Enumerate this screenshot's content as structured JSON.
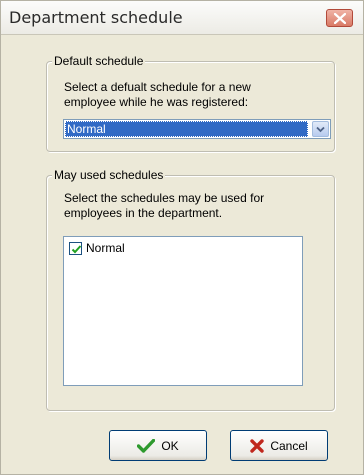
{
  "dialog": {
    "title": "Department schedule"
  },
  "default_schedule": {
    "legend": "Default schedule",
    "description_line1": "Select a defualt schedule for a new",
    "description_line2": "employee while he was registered:",
    "selected_value": "Normal"
  },
  "may_used_schedules": {
    "legend": "May used schedules",
    "description_line1": "Select the schedules may be used for",
    "description_line2": "employees in the department.",
    "items": [
      {
        "label": "Normal",
        "checked": true
      }
    ]
  },
  "buttons": {
    "ok_label": "OK",
    "cancel_label": "Cancel"
  },
  "colors": {
    "selection": "#316ac5",
    "ok_icon": "#2e9a2e",
    "cancel_icon": "#c0281e"
  }
}
